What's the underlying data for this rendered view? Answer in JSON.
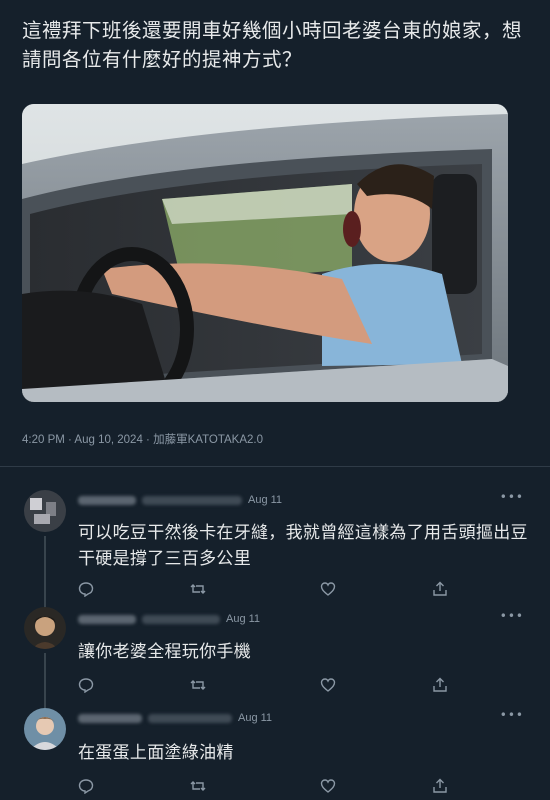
{
  "tweet": {
    "text": "這禮拜下班後還要開車好幾個小時回老婆台東的娘家，想請問各位有什麼好的提神方式？",
    "timestamp": "4:20 PM · Aug 10, 2024",
    "source": "加藤軍KATOTAKA2.0",
    "media_icon": "yawning-driver-photo"
  },
  "replies": [
    {
      "date": "Aug 11",
      "text": "可以吃豆干然後卡在牙縫，我就曾經這樣為了用舌頭摳出豆干硬是撐了三百多公里"
    },
    {
      "date": "Aug 11",
      "text": "讓你老婆全程玩你手機"
    },
    {
      "date": "Aug 11",
      "text": "在蛋蛋上面塗綠油精"
    }
  ],
  "icons": [
    "reply-icon",
    "retweet-icon",
    "like-icon",
    "share-icon",
    "more-icon"
  ],
  "colors": {
    "background": "#15202b",
    "text": "#e7e9ea",
    "muted": "#8b98a5"
  }
}
